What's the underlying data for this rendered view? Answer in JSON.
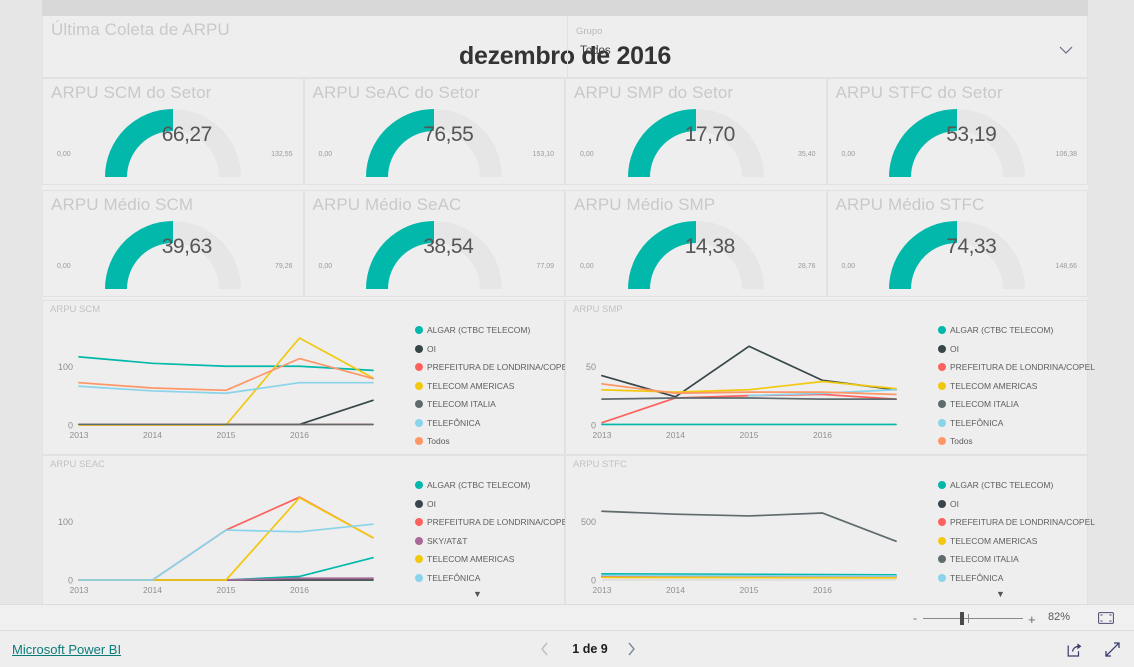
{
  "header": {
    "title": "Última Coleta de ARPU",
    "date_value": "dezembro de 2016",
    "slicer_label": "Grupo",
    "slicer_value": "Todos",
    "chevron_icon": "chevron-down-icon"
  },
  "theme": {
    "accent": "#01b8aa",
    "canvas_bg": "#eeeeee",
    "tile_border": "#e1e1e1",
    "title_gray": "#c9c9c9",
    "link_teal": "#0b7c79"
  },
  "gauges": [
    {
      "title": "ARPU SCM do Setor",
      "value": "66,27",
      "min": "0,00",
      "max": "132,55",
      "pct": 50
    },
    {
      "title": "ARPU SeAC do Setor",
      "value": "76,55",
      "min": "0,00",
      "max": "153,10",
      "pct": 50
    },
    {
      "title": "ARPU SMP do Setor",
      "value": "17,70",
      "min": "0,00",
      "max": "35,40",
      "pct": 50
    },
    {
      "title": "ARPU STFC do Setor",
      "value": "53,19",
      "min": "0,00",
      "max": "106,38",
      "pct": 50
    },
    {
      "title": "ARPU Médio SCM",
      "value": "39,63",
      "min": "0,00",
      "max": "79,26",
      "pct": 50
    },
    {
      "title": "ARPU Médio SeAC",
      "value": "38,54",
      "min": "0,00",
      "max": "77,09",
      "pct": 50
    },
    {
      "title": "ARPU Médio SMP",
      "value": "14,38",
      "min": "0,00",
      "max": "28,76",
      "pct": 50
    },
    {
      "title": "ARPU Médio STFC",
      "value": "74,33",
      "min": "0,00",
      "max": "148,66",
      "pct": 50
    }
  ],
  "chart_data": [
    {
      "id": "arpu-scm",
      "type": "line",
      "title": "ARPU SCM",
      "x": [
        "2013",
        "2014",
        "2015",
        "2016"
      ],
      "xlabel": "",
      "ylabel": "",
      "ylim": [
        0,
        160
      ],
      "yticks": [
        0,
        100
      ],
      "ytick_labels": [
        "0",
        "100"
      ],
      "grid": false,
      "legend_position": "right",
      "series": [
        {
          "name": "ALGAR (CTBC TELECOM)",
          "color": "#01b8aa",
          "values": [
            116,
            105,
            100,
            100,
            93
          ]
        },
        {
          "name": "OI",
          "color": "#374649",
          "values": [
            1,
            1,
            1,
            1,
            42
          ]
        },
        {
          "name": "PREFEITURA DE LONDRINA/COPEL",
          "color": "#fd625e",
          "values": [
            1,
            1,
            1,
            1,
            1
          ]
        },
        {
          "name": "TELECOM AMERICAS",
          "color": "#f2c80f",
          "values": [
            0,
            0,
            0,
            148,
            80
          ]
        },
        {
          "name": "TELECOM ITALIA",
          "color": "#5f6b6d",
          "values": [
            1,
            1,
            1,
            1,
            1
          ]
        },
        {
          "name": "TELEFÔNICA",
          "color": "#8ad4eb",
          "values": [
            66,
            58,
            54,
            72,
            72
          ]
        },
        {
          "name": "Todos",
          "color": "#fe9666",
          "values": [
            72,
            63,
            59,
            113,
            79
          ]
        }
      ]
    },
    {
      "id": "arpu-smp",
      "type": "line",
      "title": "ARPU SMP",
      "x": [
        "2013",
        "2014",
        "2015",
        "2016"
      ],
      "xlabel": "",
      "ylabel": "",
      "ylim": [
        0,
        80
      ],
      "yticks": [
        0,
        50
      ],
      "ytick_labels": [
        "0",
        "50"
      ],
      "grid": false,
      "legend_position": "right",
      "series": [
        {
          "name": "ALGAR (CTBC TELECOM)",
          "color": "#01b8aa",
          "values": [
            0.5,
            0.5,
            0.5,
            0.5,
            0.5
          ]
        },
        {
          "name": "OI",
          "color": "#374649",
          "values": [
            42,
            24,
            67,
            38,
            30
          ]
        },
        {
          "name": "PREFEITURA DE LONDRINA/COPEL",
          "color": "#fd625e",
          "values": [
            2,
            23,
            25,
            26,
            22
          ]
        },
        {
          "name": "TELECOM AMERICAS",
          "color": "#f2c80f",
          "values": [
            30,
            28,
            30,
            37,
            31
          ]
        },
        {
          "name": "TELECOM ITALIA",
          "color": "#5f6b6d",
          "values": [
            22,
            23,
            23,
            22,
            22
          ]
        },
        {
          "name": "TELEFÔNICA",
          "color": "#8ad4eb",
          "values": [
            null,
            null,
            25,
            27,
            30
          ]
        },
        {
          "name": "Todos",
          "color": "#fe9666",
          "values": [
            35,
            27,
            28,
            28,
            26
          ]
        }
      ]
    },
    {
      "id": "arpu-seac",
      "type": "line",
      "title": "ARPU SEAC",
      "x": [
        "2013",
        "2014",
        "2015",
        "2016"
      ],
      "xlabel": "",
      "ylabel": "",
      "ylim": [
        0,
        160
      ],
      "yticks": [
        0,
        100
      ],
      "ytick_labels": [
        "0",
        "100"
      ],
      "grid": false,
      "legend_position": "right",
      "legend_scrollable": true,
      "series": [
        {
          "name": "ALGAR (CTBC TELECOM)",
          "color": "#01b8aa",
          "values": [
            0,
            0,
            0,
            6,
            38
          ]
        },
        {
          "name": "OI",
          "color": "#374649",
          "values": [
            0,
            0,
            0,
            0,
            0
          ]
        },
        {
          "name": "PREFEITURA DE LONDRINA/COPEL",
          "color": "#fd625e",
          "values": [
            0,
            0,
            85,
            141,
            72
          ]
        },
        {
          "name": "SKY/AT&T",
          "color": "#a66999",
          "values": [
            0,
            0,
            0,
            3,
            3
          ]
        },
        {
          "name": "TELECOM AMERICAS",
          "color": "#f2c80f",
          "values": [
            0,
            0,
            0,
            140,
            72
          ]
        },
        {
          "name": "TELEFÔNICA",
          "color": "#8ad4eb",
          "values": [
            0,
            0,
            85,
            82,
            95
          ]
        }
      ]
    },
    {
      "id": "arpu-stfc",
      "type": "line",
      "title": "ARPU STFC",
      "x": [
        "2013",
        "2014",
        "2015",
        "2016"
      ],
      "xlabel": "",
      "ylabel": "",
      "ylim": [
        0,
        800
      ],
      "yticks": [
        0,
        500
      ],
      "ytick_labels": [
        "0",
        "500"
      ],
      "grid": false,
      "legend_position": "right",
      "legend_scrollable": true,
      "series": [
        {
          "name": "ALGAR (CTBC TELECOM)",
          "color": "#01b8aa",
          "values": [
            52,
            50,
            48,
            46,
            44
          ]
        },
        {
          "name": "OI",
          "color": "#374649",
          "values": [
            30,
            28,
            26,
            25,
            24
          ]
        },
        {
          "name": "PREFEITURA DE LONDRINA/COPEL",
          "color": "#fd625e",
          "values": [
            34,
            32,
            30,
            29,
            28
          ]
        },
        {
          "name": "TELECOM AMERICAS",
          "color": "#f2c80f",
          "values": [
            22,
            21,
            20,
            19,
            18
          ]
        },
        {
          "name": "TELECOM ITALIA",
          "color": "#5f6b6d",
          "values": [
            585,
            560,
            545,
            570,
            330
          ]
        },
        {
          "name": "TELEFÔNICA",
          "color": "#8ad4eb",
          "values": [
            40,
            38,
            36,
            35,
            34
          ]
        }
      ]
    }
  ],
  "zoom_bar": {
    "minus_label": "-",
    "plus_label": "+",
    "percent": "82%",
    "fit_icon": "fit-to-page-icon"
  },
  "footer": {
    "brand": "Microsoft Power BI",
    "page_label": "1 de 9",
    "prev_icon": "chevron-left-icon",
    "next_icon": "chevron-right-icon",
    "share_icon": "share-icon",
    "fullscreen_icon": "fullscreen-icon"
  }
}
